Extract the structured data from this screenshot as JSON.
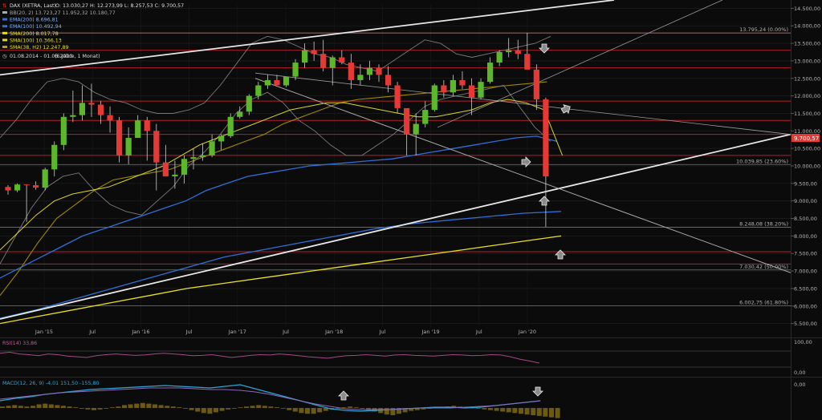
{
  "chart_data": {
    "type": "candlestick",
    "header": {
      "symbol": "DAX (XETRA, Last)",
      "ohlc": "O: 13.030,27  H: 12.273,99  L: 8.257,53  C: 9.700,57",
      "indicators": [
        {
          "label": "BB(20, 2)",
          "values": "13.723,27  11.952,32  10.180,77",
          "color": "#aaaaaa"
        },
        {
          "label": "EMA(200)",
          "values": "8.696,81",
          "color": "#2f6fd6"
        },
        {
          "label": "EMA(100)",
          "values": "10.492,94",
          "color": "#2f6fd6"
        },
        {
          "label": "SMA(200)",
          "values": "8.017,78",
          "color": "#e8e020"
        },
        {
          "label": "SMA(100)",
          "values": "10.366,13",
          "color": "#d8d820"
        },
        {
          "label": "SMA(38, H2)",
          "values": "12.247,89",
          "color": "#b8a000"
        }
      ],
      "range": "01.08.2014 - 01.06.2020",
      "period": "(6 Jahre, 1 Monat)"
    },
    "y_ticks": [
      "14.500,00",
      "14.000,00",
      "13.500,00",
      "13.000,00",
      "12.500,00",
      "12.000,00",
      "11.500,00",
      "11.000,00",
      "10.500,00",
      "10.000,00",
      "9.500,00",
      "9.000,00",
      "8.500,00",
      "8.000,00",
      "7.500,00",
      "7.000,00",
      "6.500,00",
      "6.000,00",
      "5.500,00"
    ],
    "ylim": [
      5400,
      14600
    ],
    "last_price": "9.700,57",
    "x_ticks": [
      "Jan '15",
      "Jul",
      "Jan '16",
      "Jul",
      "Jan '17",
      "Jul",
      "Jan '18",
      "Jul",
      "Jan '19",
      "Jul",
      "Jan '20"
    ],
    "fib_levels": [
      {
        "value": 13795.24,
        "label": "13.795,24 (0.00%)"
      },
      {
        "value": 10039.85,
        "label": "10.039,85 (23.60%)"
      },
      {
        "value": 8248.08,
        "label": "8.248,08 (38.20%)"
      },
      {
        "value": 7030.42,
        "label": "7.030,42 (50.00%)"
      },
      {
        "value": 6002.75,
        "label": "6.002,75 (61.80%)"
      }
    ],
    "rsi": {
      "label": "RSI(14)",
      "value": "33,86",
      "ticks": [
        "100,00",
        "0,00"
      ]
    },
    "macd": {
      "label": "MACD(12, 26, 9)",
      "values": "-4,01  151,50  -155,80",
      "ticks": [
        "0,00"
      ]
    },
    "candles": [
      [
        9400,
        9450,
        9180,
        9300
      ],
      [
        9300,
        9500,
        9250,
        9470
      ],
      [
        9470,
        9450,
        8400,
        9450
      ],
      [
        9450,
        9560,
        9320,
        9380
      ],
      [
        9380,
        9950,
        9300,
        9900
      ],
      [
        9900,
        10700,
        9700,
        10600
      ],
      [
        10600,
        11500,
        10450,
        11400
      ],
      [
        11400,
        12150,
        11250,
        11450
      ],
      [
        11450,
        12300,
        11300,
        11800
      ],
      [
        11800,
        12350,
        11400,
        11750
      ],
      [
        11750,
        11850,
        11200,
        11450
      ],
      [
        11450,
        11700,
        10950,
        11300
      ],
      [
        11300,
        11400,
        10100,
        10300
      ],
      [
        10300,
        11100,
        10050,
        10800
      ],
      [
        10800,
        11450,
        10850,
        11300
      ],
      [
        11300,
        11400,
        10150,
        11000
      ],
      [
        11000,
        11200,
        9300,
        10100
      ],
      [
        10100,
        10600,
        9700,
        9700
      ],
      [
        9700,
        10150,
        9350,
        9750
      ],
      [
        9750,
        10300,
        9500,
        10200
      ],
      [
        10200,
        10500,
        9900,
        10250
      ],
      [
        10250,
        10650,
        10150,
        10300
      ],
      [
        10300,
        10900,
        10250,
        10700
      ],
      [
        10700,
        10900,
        10450,
        10850
      ],
      [
        10850,
        11500,
        10800,
        11400
      ],
      [
        11400,
        11700,
        11350,
        11550
      ],
      [
        11550,
        12050,
        11450,
        12000
      ],
      [
        12000,
        12400,
        11900,
        12300
      ],
      [
        12300,
        12600,
        12200,
        12450
      ],
      [
        12450,
        12600,
        12300,
        12300
      ],
      [
        12300,
        12500,
        12250,
        12550
      ],
      [
        12550,
        13050,
        12450,
        12950
      ],
      [
        12950,
        13500,
        12800,
        13300
      ],
      [
        13300,
        13550,
        13000,
        13200
      ],
      [
        13200,
        13600,
        12700,
        12800
      ],
      [
        12800,
        13150,
        12300,
        13100
      ],
      [
        13100,
        13300,
        12900,
        12950
      ],
      [
        12950,
        13200,
        12200,
        12450
      ],
      [
        12450,
        12900,
        12300,
        12600
      ],
      [
        12600,
        13000,
        12450,
        12800
      ],
      [
        12800,
        12900,
        12400,
        12600
      ],
      [
        12600,
        12850,
        12100,
        12300
      ],
      [
        12300,
        12400,
        11500,
        11650
      ],
      [
        11650,
        11600,
        10300,
        10900
      ],
      [
        10900,
        11500,
        10300,
        11200
      ],
      [
        11200,
        11850,
        11100,
        11600
      ],
      [
        11600,
        12350,
        11550,
        12300
      ],
      [
        12300,
        12450,
        11950,
        12100
      ],
      [
        12100,
        12600,
        12000,
        12450
      ],
      [
        12450,
        12700,
        12200,
        12300
      ],
      [
        12300,
        12500,
        11450,
        11950
      ],
      [
        11950,
        12500,
        11900,
        12400
      ],
      [
        12400,
        13100,
        12350,
        12950
      ],
      [
        12950,
        13300,
        12850,
        13250
      ],
      [
        13250,
        13650,
        13100,
        13300
      ],
      [
        13300,
        13600,
        13050,
        13200
      ],
      [
        13200,
        13800,
        12900,
        12750
      ],
      [
        12750,
        12900,
        11600,
        11900
      ],
      [
        11900,
        11950,
        8257,
        9700
      ]
    ],
    "overlays_note": "Bollinger bands, EMA(200), EMA(100), SMA(200), SMA(100), SMA(38,H2), trend lines"
  }
}
